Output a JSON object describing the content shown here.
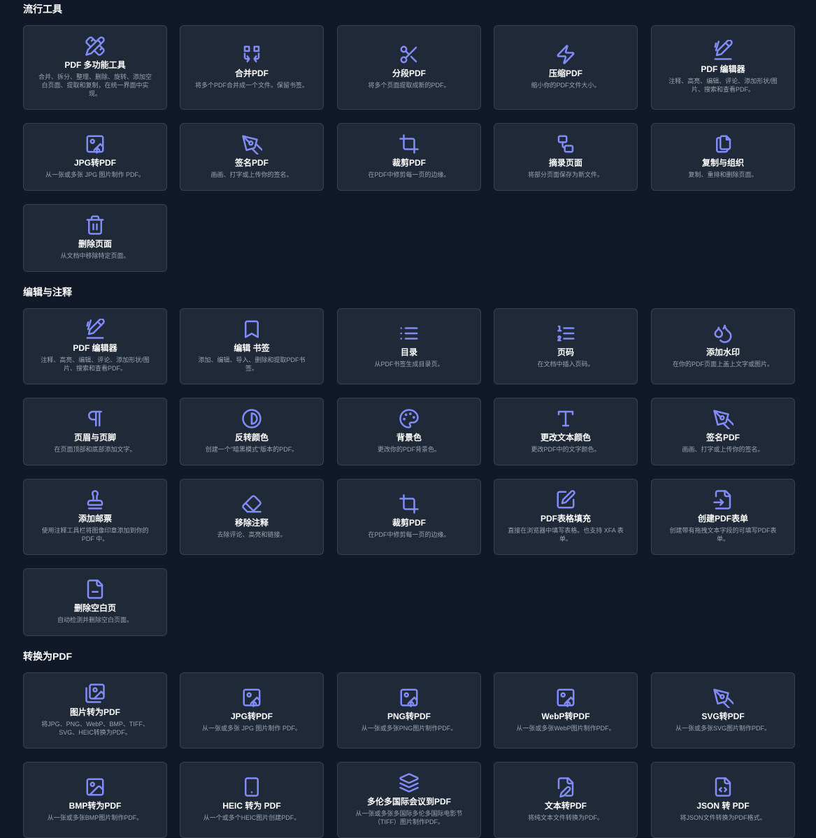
{
  "accent_color": "#818cf8",
  "sections": [
    {
      "title": "流行工具",
      "cards": [
        {
          "name": "pdf-multi-tool",
          "icon": "pencil-ruler-icon",
          "title": "PDF 多功能工具",
          "desc": "合并、拆分、整理、删除、旋转、添加空白页面、提取和复制，在统一界面中实现。"
        },
        {
          "name": "merge-pdf",
          "icon": "merge-icon",
          "title": "合并PDF",
          "desc": "将多个PDF合并成一个文件。保留书签。"
        },
        {
          "name": "split-pdf",
          "icon": "scissors-icon",
          "title": "分段PDF",
          "desc": "将多个页面提取成新的PDF。"
        },
        {
          "name": "compress-pdf",
          "icon": "lightning-icon",
          "title": "压缩PDF",
          "desc": "缩小你的PDF文件大小。"
        },
        {
          "name": "pdf-editor",
          "icon": "edit-icon",
          "title": "PDF 编辑器",
          "desc": "注释、高亮、编辑、评论、添加形状/图片、搜索和查看PDF。"
        },
        {
          "name": "jpg-to-pdf",
          "icon": "image-upload-icon",
          "title": "JPG转PDF",
          "desc": "从一张或多张 JPG 图片制作 PDF。"
        },
        {
          "name": "sign-pdf",
          "icon": "pen-nib-icon",
          "title": "签名PDF",
          "desc": "画画、打字或上传你的签名。"
        },
        {
          "name": "crop-pdf",
          "icon": "crop-icon",
          "title": "裁剪PDF",
          "desc": "在PDF中修剪每一页的边缘。"
        },
        {
          "name": "extract-pages",
          "icon": "extract-icon",
          "title": "摘录页面",
          "desc": "将部分页面保存为新文件。"
        },
        {
          "name": "copy-organize",
          "icon": "copy-icon",
          "title": "复制与组织",
          "desc": "复制、重排和删除页面。"
        },
        {
          "name": "delete-pages",
          "icon": "trash-icon",
          "title": "删除页面",
          "desc": "从文档中移除特定页面。"
        }
      ]
    },
    {
      "title": "编辑与注释",
      "cards": [
        {
          "name": "pdf-editor-2",
          "icon": "edit-icon",
          "title": "PDF 编辑器",
          "desc": "注释、高亮、编辑、评论、添加形状/图片、搜索和查看PDF。"
        },
        {
          "name": "edit-bookmarks",
          "icon": "bookmark-icon",
          "title": "编辑 书签",
          "desc": "添加、编辑、导入、删除和提取PDF书签。"
        },
        {
          "name": "table-of-contents",
          "icon": "list-icon",
          "title": "目录",
          "desc": "从PDF书签生成目录页。"
        },
        {
          "name": "page-numbers",
          "icon": "numbered-list-icon",
          "title": "页码",
          "desc": "在文档中插入页码。"
        },
        {
          "name": "add-watermark",
          "icon": "droplets-icon",
          "title": "添加水印",
          "desc": "在你的PDF页面上盖上文字或图片。"
        },
        {
          "name": "header-footer",
          "icon": "pilcrow-icon",
          "title": "页眉与页脚",
          "desc": "在页面顶部和底部添加文字。"
        },
        {
          "name": "invert-colors",
          "icon": "contrast-icon",
          "title": "反转颜色",
          "desc": "创建一个\"暗黑模式\"版本的PDF。"
        },
        {
          "name": "background-color",
          "icon": "palette-icon",
          "title": "背景色",
          "desc": "更改你的PDF背景色。"
        },
        {
          "name": "change-text-color",
          "icon": "type-icon",
          "title": "更改文本颜色",
          "desc": "更改PDF中的文字颜色。"
        },
        {
          "name": "sign-pdf-2",
          "icon": "pen-nib-icon",
          "title": "签名PDF",
          "desc": "画画、打字或上传你的签名。"
        },
        {
          "name": "add-stamp",
          "icon": "stamp-icon",
          "title": "添加邮票",
          "desc": "使用注释工具栏将图像印章添加到你的 PDF 中。"
        },
        {
          "name": "remove-annotations",
          "icon": "eraser-icon",
          "title": "移除注释",
          "desc": "去除评论、高亮和链接。"
        },
        {
          "name": "crop-pdf-2",
          "icon": "crop-icon",
          "title": "裁剪PDF",
          "desc": "在PDF中修剪每一页的边缘。"
        },
        {
          "name": "pdf-form-filler",
          "icon": "edit-square-icon",
          "title": "PDF表格填充",
          "desc": "直接在浏览器中填写表格。也支持 XFA 表单。"
        },
        {
          "name": "create-pdf-form",
          "icon": "file-input-icon",
          "title": "创建PDF表单",
          "desc": "创建带有拖拽文本字段的可填写PDF表单。"
        },
        {
          "name": "remove-blank-pages",
          "icon": "file-minus-icon",
          "title": "删除空白页",
          "desc": "自动检测并删除空白页面。"
        }
      ]
    },
    {
      "title": "转换为PDF",
      "cards": [
        {
          "name": "images-to-pdf",
          "icon": "images-icon",
          "title": "图片转为PDF",
          "desc": "将JPG、PNG、WebP、BMP、TIFF、SVG、HEIC转换为PDF。"
        },
        {
          "name": "jpg-to-pdf-2",
          "icon": "image-upload-icon",
          "title": "JPG转PDF",
          "desc": "从一张或多张 JPG 图片制作 PDF。"
        },
        {
          "name": "png-to-pdf",
          "icon": "image-upload-icon",
          "title": "PNG转PDF",
          "desc": "从一张或多张PNG图片制作PDF。"
        },
        {
          "name": "webp-to-pdf",
          "icon": "image-upload-icon",
          "title": "WebP转PDF",
          "desc": "从一张或多张WebP图片制作PDF。"
        },
        {
          "name": "svg-to-pdf",
          "icon": "pen-nib-icon",
          "title": "SVG转PDF",
          "desc": "从一张或多张SVG图片制作PDF。"
        },
        {
          "name": "bmp-to-pdf",
          "icon": "image-icon",
          "title": "BMP转为PDF",
          "desc": "从一张或多张BMP图片制作PDF。"
        },
        {
          "name": "heic-to-pdf",
          "icon": "phone-icon",
          "title": "HEIC 转为 PDF",
          "desc": "从一个或多个HEIC图片创建PDF。"
        },
        {
          "name": "tiff-to-pdf",
          "icon": "layers-icon",
          "title": "多伦多国际会议到PDF",
          "desc": "从一张或多张多国际多伦多国际电影节（TIFF）图片制作PDF。"
        },
        {
          "name": "text-to-pdf",
          "icon": "file-pen-icon",
          "title": "文本转PDF",
          "desc": "将纯文本文件转换为PDF。"
        },
        {
          "name": "json-to-pdf",
          "icon": "file-code-icon",
          "title": "JSON 转 PDF",
          "desc": "将JSON文件转换为PDF格式。"
        }
      ]
    }
  ]
}
